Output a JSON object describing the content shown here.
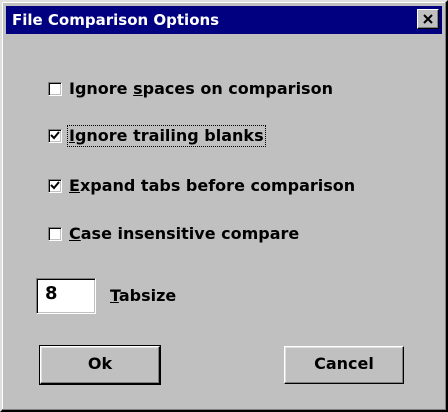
{
  "window": {
    "title": "File Comparison Options"
  },
  "options": [
    {
      "pre": "Ignore ",
      "mnemonic": "s",
      "post": "paces on comparison",
      "checked": false
    },
    {
      "pre": "",
      "mnemonic": "I",
      "post": "gnore trailing blanks",
      "checked": true
    },
    {
      "pre": "",
      "mnemonic": "E",
      "post": "xpand tabs before comparison",
      "checked": true
    },
    {
      "pre": "",
      "mnemonic": "C",
      "post": "ase insensitive compare",
      "checked": false
    }
  ],
  "tabsize": {
    "value": "8",
    "label_mnemonic": "T",
    "label_rest": "absize"
  },
  "buttons": {
    "ok": "Ok",
    "cancel": "Cancel"
  },
  "colors": {
    "title_bar": "#000080",
    "face": "#c0c0c0"
  }
}
